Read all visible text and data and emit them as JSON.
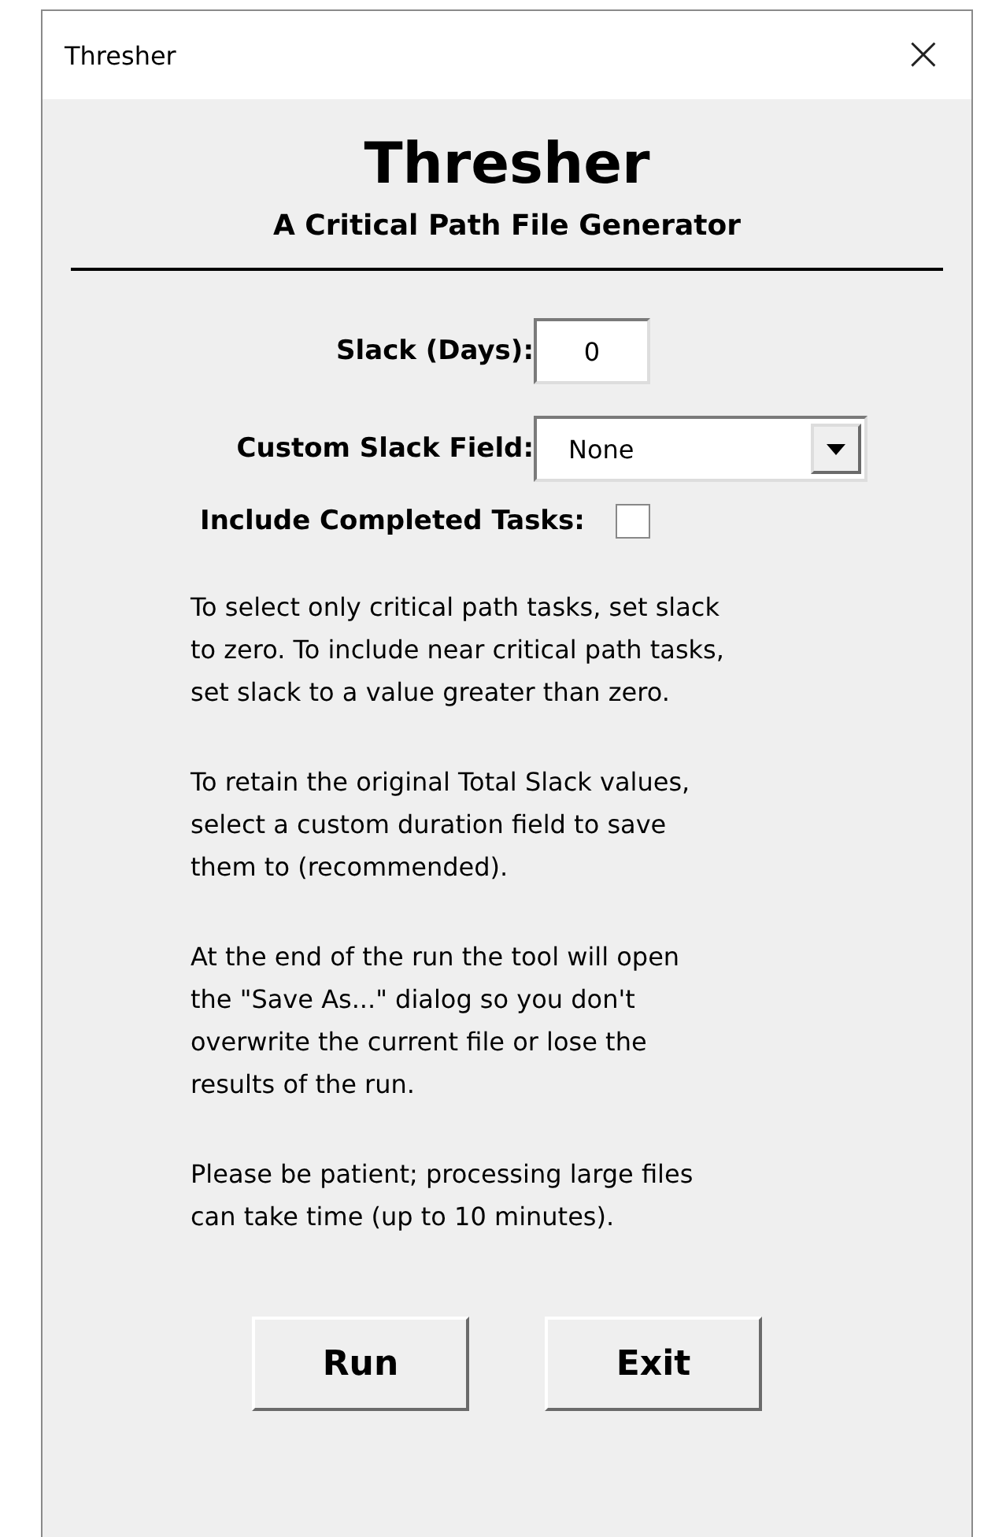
{
  "window": {
    "title": "Thresher",
    "close": "×"
  },
  "heading": "Thresher",
  "subheading": "A Critical Path File Generator",
  "slack": {
    "label": "Slack (Days):",
    "value": "0"
  },
  "custom_slack_field": {
    "label": "Custom Slack Field:",
    "value": "None"
  },
  "include_completed": {
    "label": "Include Completed Tasks:",
    "checked": false
  },
  "paragraphs": [
    {
      "lines": [
        "To select only critical path tasks, set slack",
        "to zero. To include near critical path tasks,",
        "set slack to a value greater than zero."
      ]
    },
    {
      "lines": [
        "To retain the original Total Slack values,",
        "select a custom duration field to save",
        "them to (recommended)."
      ]
    },
    {
      "lines": [
        "At the end of the run the tool will open",
        "the \"Save As...\" dialog so you don't",
        "overwrite the current file or lose the",
        "results of the run."
      ]
    },
    {
      "lines": [
        "Please be patient; processing large files",
        "can take time (up to 10 minutes)."
      ]
    }
  ],
  "buttons": [
    "Run",
    "Exit"
  ]
}
